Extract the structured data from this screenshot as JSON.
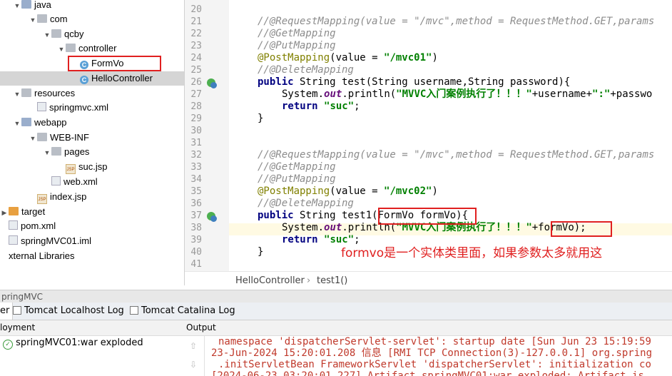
{
  "project_tree": {
    "items": [
      {
        "label": "java",
        "type": "folder-blue",
        "arrow": "v"
      },
      {
        "label": "com",
        "type": "folder",
        "arrow": "v"
      },
      {
        "label": "qcby",
        "type": "folder",
        "arrow": "v"
      },
      {
        "label": "controller",
        "type": "folder",
        "arrow": "v"
      },
      {
        "label": "FormVo",
        "type": "class",
        "arrow": ""
      },
      {
        "label": "HelloController",
        "type": "class",
        "arrow": ""
      },
      {
        "label": "resources",
        "type": "folder",
        "arrow": "v"
      },
      {
        "label": "springmvc.xml",
        "type": "xml",
        "arrow": ""
      },
      {
        "label": "webapp",
        "type": "folder-blue",
        "arrow": "v"
      },
      {
        "label": "WEB-INF",
        "type": "folder",
        "arrow": "v"
      },
      {
        "label": "pages",
        "type": "folder",
        "arrow": "v"
      },
      {
        "label": "suc.jsp",
        "type": "jsp",
        "arrow": ""
      },
      {
        "label": "web.xml",
        "type": "xml",
        "arrow": ""
      },
      {
        "label": "index.jsp",
        "type": "jsp",
        "arrow": ""
      },
      {
        "label": "target",
        "type": "folder-orange",
        "arrow": ">"
      },
      {
        "label": "pom.xml",
        "type": "xml",
        "arrow": ""
      },
      {
        "label": "springMVC01.iml",
        "type": "iml",
        "arrow": ""
      },
      {
        "label": "xternal Libraries",
        "type": "lib",
        "arrow": ""
      }
    ]
  },
  "editor": {
    "line_numbers": [
      "20",
      "21",
      "22",
      "23",
      "24",
      "25",
      "26",
      "27",
      "28",
      "29",
      "30",
      "31",
      "32",
      "33",
      "34",
      "35",
      "36",
      "37",
      "38",
      "39",
      "40",
      "41"
    ],
    "lines": {
      "l21": "//@RequestMapping(value = \"/mvc\",method = RequestMethod.GET,params",
      "l22": "//@GetMapping",
      "l23": "//@PutMapping",
      "l24a": "@PostMapping",
      "l24b": "(value = ",
      "l24c": "\"/mvc01\"",
      "l24d": ")",
      "l25": "//@DeleteMapping",
      "l26a": "public",
      "l26b": " String test(String username,String password){",
      "l27a": "System.",
      "l27b": "out",
      "l27c": ".println(",
      "l27d": "\"MVVC入门案例执行了！！！\"",
      "l27e": "+username+",
      "l27f": "\":\"",
      "l27g": "+passwo",
      "l28a": "return",
      "l28b": " ",
      "l28c": "\"suc\"",
      "l28d": ";",
      "l29": "}",
      "l32": "//@RequestMapping(value = \"/mvc\",method = RequestMethod.GET,params",
      "l33": "//@GetMapping",
      "l34": "//@PutMapping",
      "l35a": "@PostMapping",
      "l35b": "(value = ",
      "l35c": "\"/mvc02\"",
      "l35d": ")",
      "l36": "//@DeleteMapping",
      "l37a": "public",
      "l37b": " String test1(FormVo formVo){",
      "l38a": "System.",
      "l38b": "out",
      "l38c": ".println(",
      "l38d": "\"MVVC入门案例执行了！！！\"",
      "l38e": "+formVo);",
      "l39a": "return",
      "l39b": " ",
      "l39c": "\"suc\"",
      "l39d": ";",
      "l40": "}"
    },
    "note": "formvo是一个实体类里面，如果参数太多就用这"
  },
  "breadcrumb": {
    "class_name": "HelloController",
    "separator": "›",
    "method": "test1()"
  },
  "bottom": {
    "title": "pringMVC",
    "tabs": [
      "er",
      "Tomcat Localhost Log",
      "Tomcat Catalina Log"
    ],
    "deployment_header": "loyment",
    "deployment_item": "springMVC01:war exploded",
    "output_header": "Output",
    "output_lines": [
      "namespace 'dispatcherServlet-servlet': startup date [Sun Jun 23 15:19:59",
      "23-Jun-2024 15:20:01.208 信息 [RMI TCP Connection(3)-127.0.0.1] org.spring",
      ".initServletBean FrameworkServlet 'dispatcherServlet': initialization co",
      "[2024-06-23 03:20:01,227] Artifact springMVC01:war exploded: Artifact is"
    ]
  },
  "colors": {
    "highlight_box": "#e02020",
    "selected_row": "#d5d5d5"
  }
}
